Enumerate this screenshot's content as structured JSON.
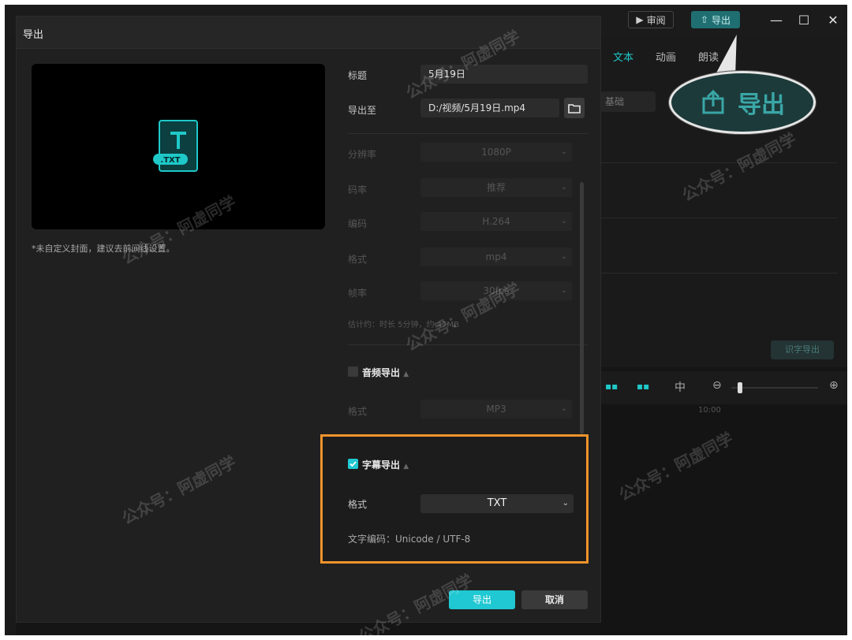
{
  "app": {
    "review_label": "审阅",
    "export_label": "导出",
    "right_tabs": [
      "文本",
      "动画",
      "朗读"
    ],
    "right_field_label": "基础",
    "right_action_label": "识字导出",
    "timeline_zoom_label": "10:00",
    "accent": "#1fc8c8"
  },
  "callout": {
    "label": "导出"
  },
  "dialog": {
    "title": "导出",
    "cover_hint": "*未自定义封面，建议去前间线设置。",
    "title_label": "标题",
    "title_value": "5月19日",
    "export_to_label": "导出至",
    "export_to_value": "D:/视频/5月19日.mp4",
    "video_settings": [
      {
        "label": "分辨率",
        "value": "1080P"
      },
      {
        "label": "码率",
        "value": "推荐"
      },
      {
        "label": "编码",
        "value": "H.264"
      },
      {
        "label": "格式",
        "value": "mp4"
      },
      {
        "label": "帧率",
        "value": "30fps"
      }
    ],
    "video_estimate": "估计约：时长 5分钟，约 47MB",
    "audio_export_label": "音频导出",
    "audio_format_label": "格式",
    "audio_format_value": "MP3",
    "subtitle_export_label": "字幕导出",
    "subtitle_format_label": "格式",
    "subtitle_format_value": "TXT",
    "subtitle_encoding": "文字编码：Unicode / UTF-8",
    "export_button": "导出",
    "cancel_button": "取消"
  },
  "watermark_text": "公众号：阿虚同学"
}
